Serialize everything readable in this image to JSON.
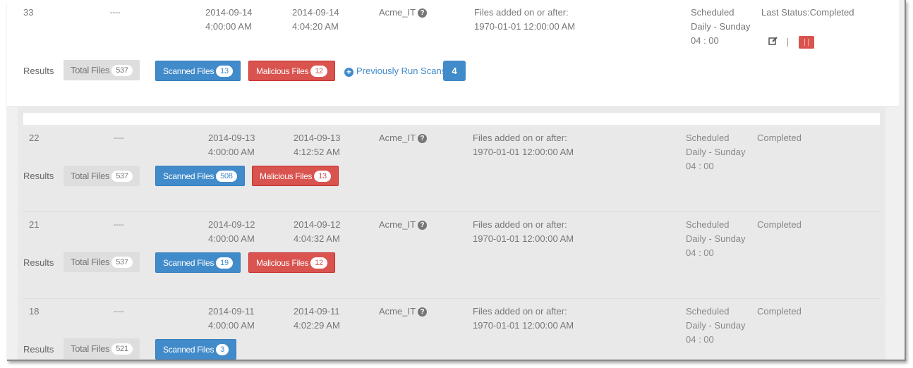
{
  "scans": [
    {
      "id": "33",
      "name": "----",
      "start": "2014-09-14 4:00:00 AM",
      "end": "2014-09-14 4:04:20 AM",
      "owner": "Acme_IT",
      "criteria": "Files added on or after: 1970-01-01 12:00:00 AM",
      "schedule": "Scheduled Daily - Sunday 04 : 00",
      "status": "Last Status:Completed",
      "results_label": "Results",
      "total_label": "Total Files",
      "total_count": "537",
      "scanned_label": "Scanned Files",
      "scanned_count": "13",
      "malicious_label": "Malicious Files",
      "malicious_count": "12",
      "previous_label": "Previously Run Scans -",
      "previous_count": "4"
    },
    {
      "id": "22",
      "name": "----",
      "start": "2014-09-13 4:00:00 AM",
      "end": "2014-09-13 4:12:52 AM",
      "owner": "Acme_IT",
      "criteria": "Files added on or after: 1970-01-01 12:00:00 AM",
      "schedule": "Scheduled Daily - Sunday 04 : 00",
      "status": "Completed",
      "results_label": "Results",
      "total_label": "Total Files",
      "total_count": "537",
      "scanned_label": "Scanned Files",
      "scanned_count": "508",
      "malicious_label": "Malicious Files",
      "malicious_count": "13"
    },
    {
      "id": "21",
      "name": "----",
      "start": "2014-09-12 4:00:00 AM",
      "end": "2014-09-12 4:04:32 AM",
      "owner": "Acme_IT",
      "criteria": "Files added on or after: 1970-01-01 12:00:00 AM",
      "schedule": "Scheduled Daily - Sunday 04 : 00",
      "status": "Completed",
      "results_label": "Results",
      "total_label": "Total Files",
      "total_count": "537",
      "scanned_label": "Scanned Files",
      "scanned_count": "19",
      "malicious_label": "Malicious Files",
      "malicious_count": "12"
    },
    {
      "id": "18",
      "name": "----",
      "start": "2014-09-11 4:00:00 AM",
      "end": "2014-09-11 4:02:29 AM",
      "owner": "Acme_IT",
      "criteria": "Files added on or after: 1970-01-01 12:00:00 AM",
      "schedule": "Scheduled Daily - Sunday 04 : 00",
      "status": "Completed",
      "results_label": "Results",
      "total_label": "Total Files",
      "total_count": "521",
      "scanned_label": "Scanned Files",
      "scanned_count": "3"
    }
  ],
  "icons": {
    "help": "question-circle-icon",
    "plus": "plus-circle-icon",
    "edit": "edit-icon",
    "trash": "trash-icon"
  },
  "colors": {
    "primary": "#428bca",
    "danger": "#d9534f",
    "muted": "#dedede"
  }
}
